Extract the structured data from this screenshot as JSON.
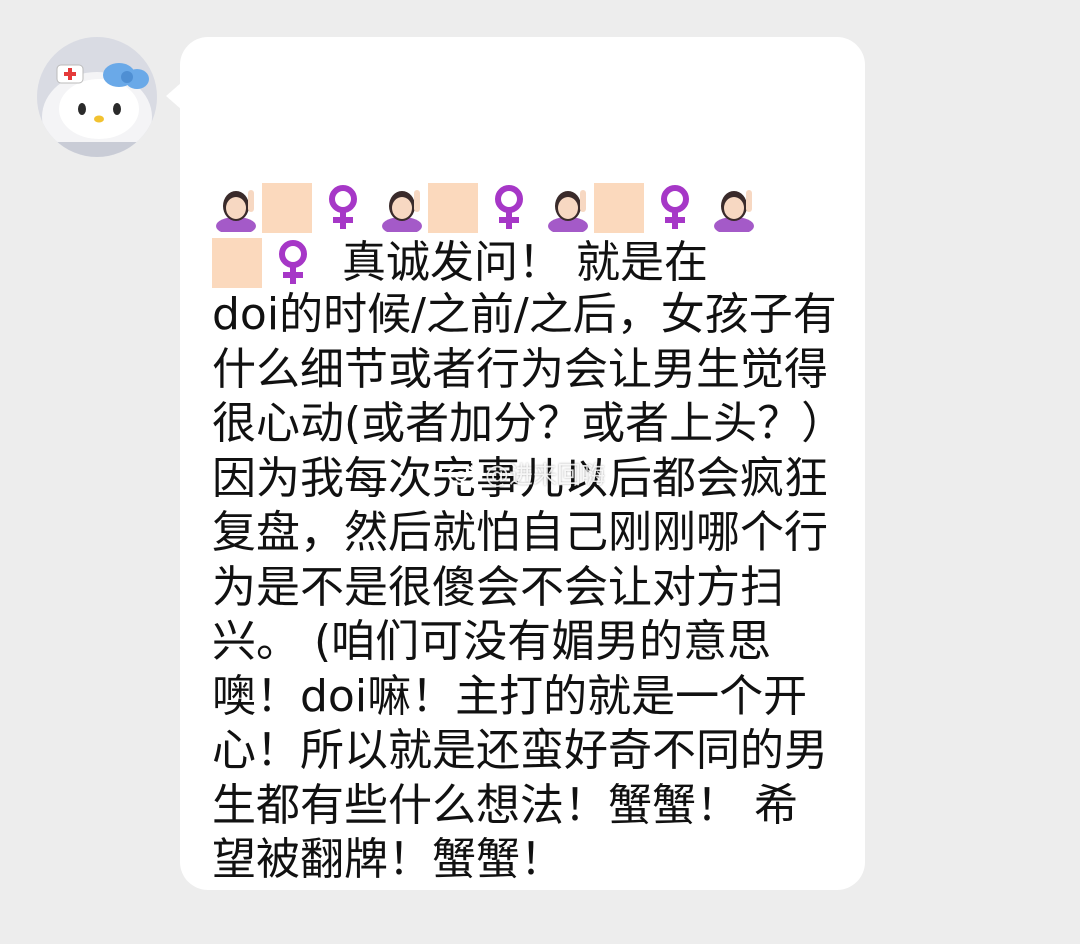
{
  "chat": {
    "sender_avatar": "hello-kitty-avatar",
    "message": {
      "emoji_row_1_icons": [
        "raising-hand-woman-icon",
        "tofu-box-icon",
        "female-sign-icon",
        "raising-hand-woman-icon",
        "tofu-box-icon",
        "female-sign-icon",
        "raising-hand-woman-icon",
        "tofu-box-icon",
        "female-sign-icon",
        "raising-hand-woman-icon"
      ],
      "emoji_row_2_icons": [
        "tofu-box-icon",
        "female-sign-icon"
      ],
      "line2_text": " 真诚发问！ 就是在",
      "body": "doi的时候/之前/之后，女孩子有什么细节或者行为会让男生觉得很心动(或者加分？或者上头？）因为我每次完事儿以后都会疯狂复盘，然后就怕自己刚刚哪个行为是不是很傻会不会让对方扫兴。 (咱们可没有媚男的意思噢！doi嘛！主打的就是一个开心！所以就是还蛮好奇不同的男生都有些什么想法！蟹蟹！ 希望被翻牌！蟹蟹！"
    }
  },
  "watermark": {
    "text": "@进来回嗨",
    "icon": "weibo-logo-icon"
  },
  "colors": {
    "page_background": "#ededed",
    "bubble_background": "#ffffff",
    "text": "#111111",
    "female_sign": "#a637c7",
    "tofu_box": "#fbd9bd"
  }
}
